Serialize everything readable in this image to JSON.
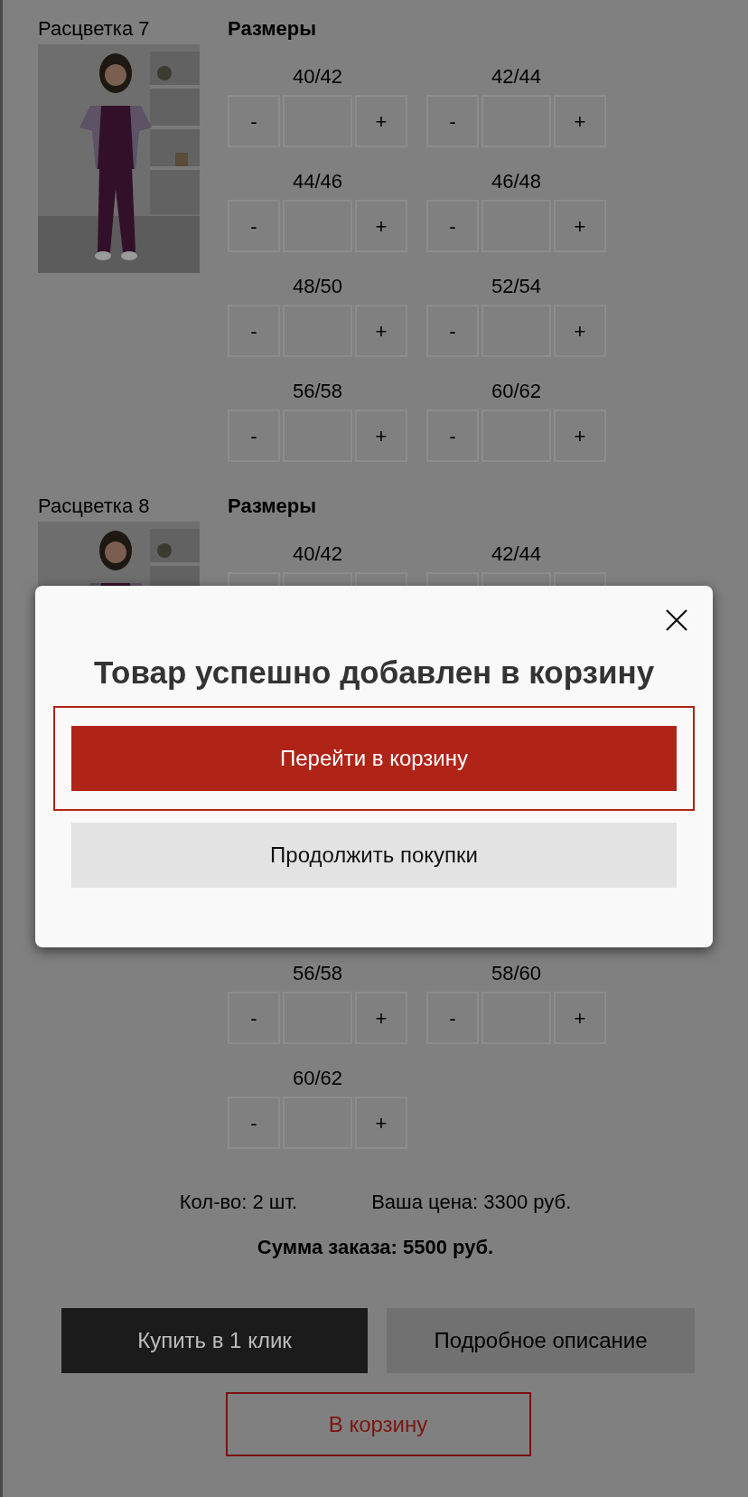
{
  "sections": [
    {
      "title": "Расцветка 7",
      "sizes_heading": "Размеры",
      "sizes": [
        {
          "label": "40/42",
          "minus": "-",
          "plus": "+"
        },
        {
          "label": "42/44",
          "minus": "-",
          "plus": "+"
        },
        {
          "label": "44/46",
          "minus": "-",
          "plus": "+"
        },
        {
          "label": "46/48",
          "minus": "-",
          "plus": "+"
        },
        {
          "label": "48/50",
          "minus": "-",
          "plus": "+"
        },
        {
          "label": "52/54",
          "minus": "-",
          "plus": "+"
        },
        {
          "label": "56/58",
          "minus": "-",
          "plus": "+"
        },
        {
          "label": "60/62",
          "minus": "-",
          "plus": "+"
        }
      ]
    },
    {
      "title": "Расцветка 8",
      "sizes_heading": "Размеры",
      "sizes": [
        {
          "label": "40/42"
        },
        {
          "label": "42/44"
        },
        {
          "label": "56/58",
          "minus": "-",
          "plus": "+"
        },
        {
          "label": "58/60",
          "minus": "-",
          "plus": "+"
        },
        {
          "label": "60/62",
          "minus": "-",
          "plus": "+"
        }
      ]
    }
  ],
  "summary": {
    "quantity": "Кол-во: 2 шт.",
    "price": "Ваша цена: 3300 руб.",
    "total": "Сумма заказа: 5500 руб."
  },
  "buttons": [
    {
      "kind": "dark",
      "label": "Купить в 1 клик"
    },
    {
      "kind": "light",
      "label": "Подробное описание"
    },
    {
      "kind": "outline",
      "label": "В корзину"
    }
  ],
  "modal": {
    "title": "Товар успешно добавлен в корзину",
    "buttons": [
      {
        "kind": "primary",
        "label": "Перейти в корзину",
        "focused": true
      },
      {
        "kind": "secondary",
        "label": "Продолжить покупки",
        "focused": false
      }
    ]
  }
}
